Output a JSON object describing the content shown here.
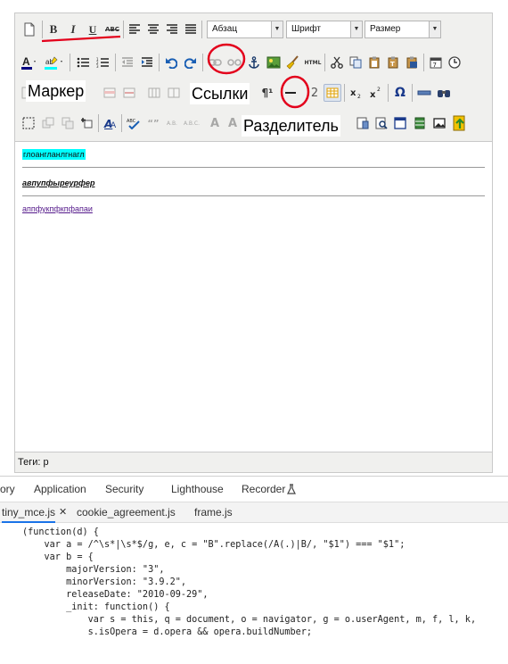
{
  "toolbar": {
    "format_select": "Абзац",
    "font_select": "Шрифт",
    "size_select": "Размер",
    "bold": "B",
    "italic": "I",
    "underline": "U",
    "strike": "ABC",
    "html": "HTML",
    "abc": "ABC"
  },
  "annotations": {
    "marker": "Маркер",
    "links": "Ссылки",
    "divider": "Разделитель"
  },
  "content": {
    "line1": "глоангланлгнагл",
    "line2": "авпупфыреурфер",
    "line3": "аппфукпфкпфапаи"
  },
  "status": "Теги: p",
  "devtools": {
    "panels": [
      "ory",
      "Application",
      "Security",
      "Lighthouse",
      "Recorder"
    ],
    "files": [
      "tiny_mce.js",
      "cookie_agreement.js",
      "frame.js"
    ],
    "code": [
      "(function(d) {",
      "    var a = /^\\s*|\\s*$/g, e, c = \"B\".replace(/A(.)|B/, \"$1\") === \"$1\";",
      "    var b = {",
      "        majorVersion: \"3\",",
      "        minorVersion: \"3.9.2\",",
      "        releaseDate: \"2010-09-29\",",
      "        _init: function() {",
      "            var s = this, q = document, o = navigator, g = o.userAgent, m, f, l, k,",
      "            s.isOpera = d.opera && opera.buildNumber;"
    ]
  },
  "colors": {
    "annotation_circle": "#e3001b",
    "underline_mark": "#e3001b",
    "highlight": "#00ffff"
  }
}
